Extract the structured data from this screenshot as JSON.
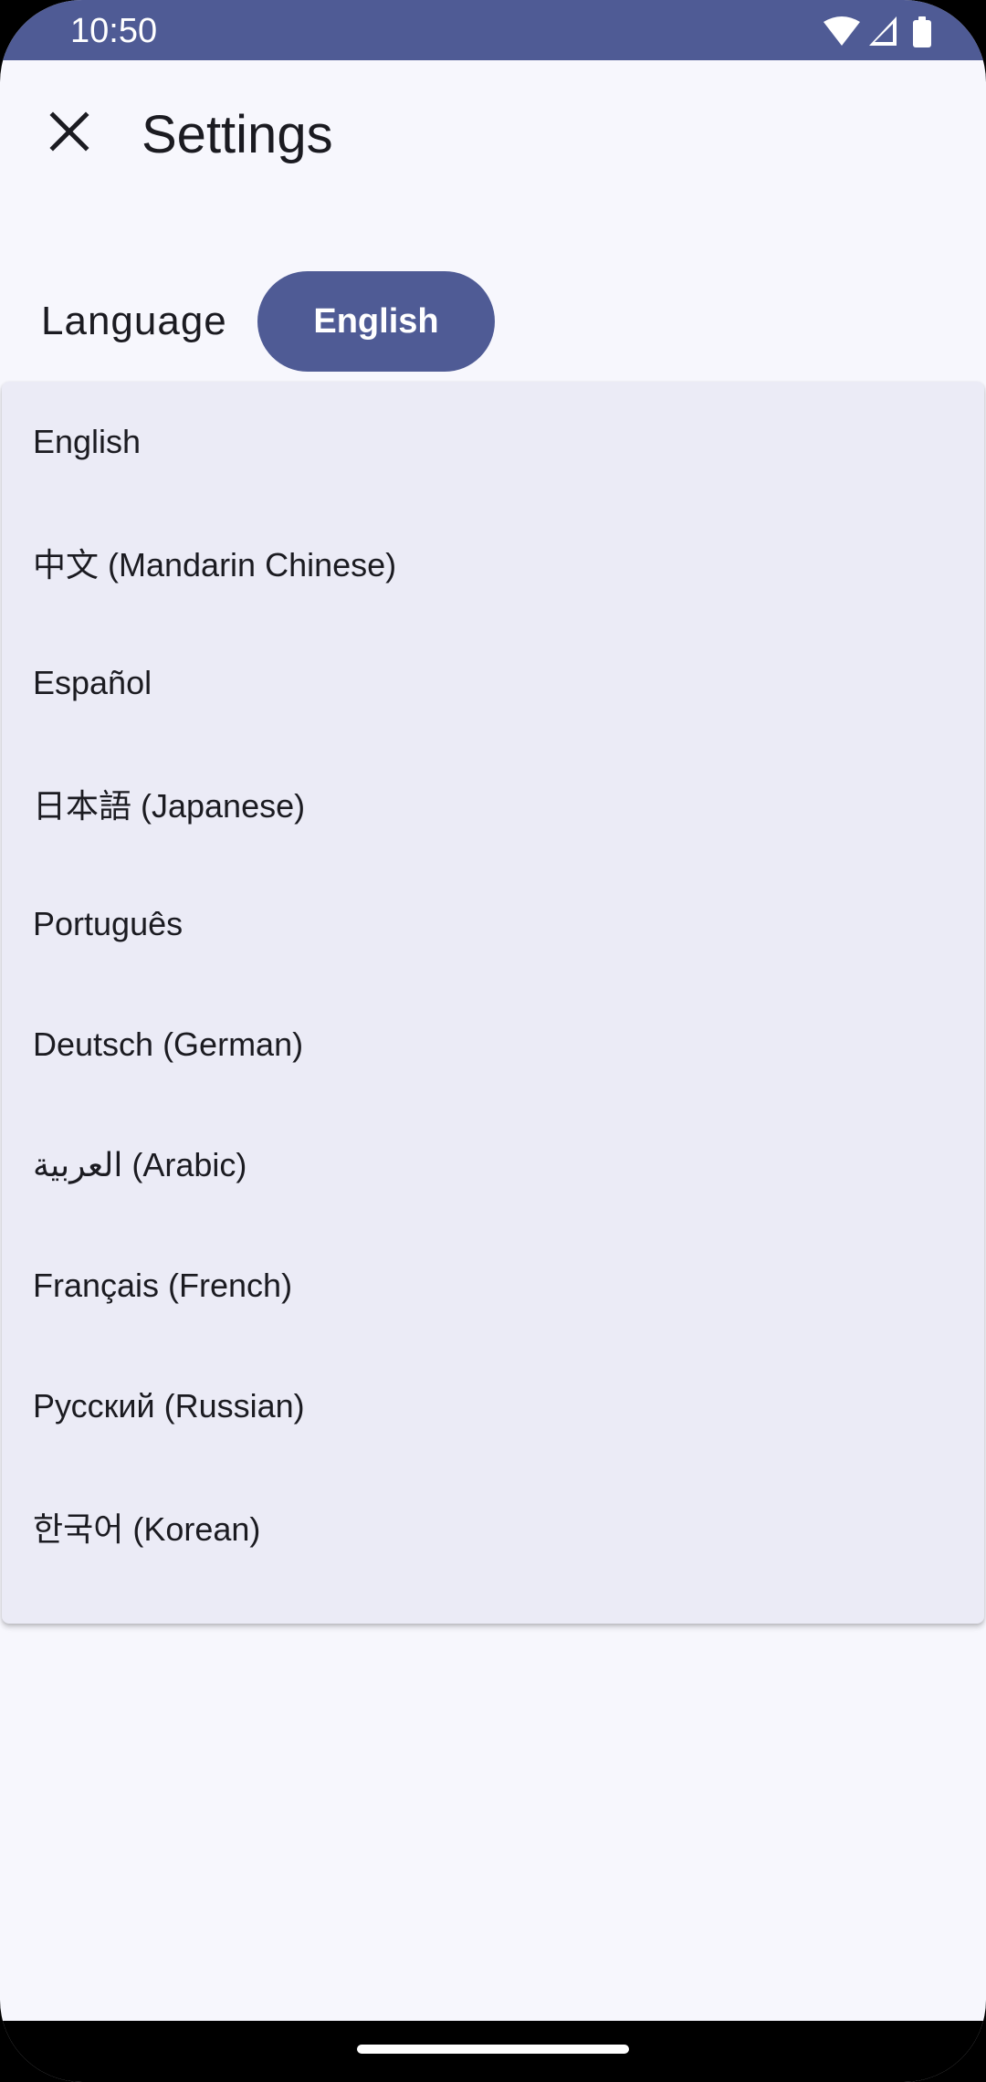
{
  "status_bar": {
    "time": "10:50",
    "icons": [
      "wifi-icon",
      "signal-icon",
      "battery-icon"
    ]
  },
  "header": {
    "title": "Settings",
    "close_icon": "close-icon"
  },
  "language": {
    "label": "Language",
    "selected": "English"
  },
  "dropdown": {
    "items": [
      {
        "label": "English"
      },
      {
        "label": "中文 (Mandarin Chinese)"
      },
      {
        "label": "Español"
      },
      {
        "label": "日本語 (Japanese)"
      },
      {
        "label": "Português"
      },
      {
        "label": "Deutsch (German)"
      },
      {
        "label": "العربية (Arabic)"
      },
      {
        "label": "Français (French)"
      },
      {
        "label": "Русский (Russian)"
      },
      {
        "label": "한국어 (Korean)"
      }
    ]
  },
  "colors": {
    "accent": "#4f5b95",
    "background": "#f7f7fd",
    "menu_background": "#ebebf6",
    "text": "#1b1b21"
  }
}
